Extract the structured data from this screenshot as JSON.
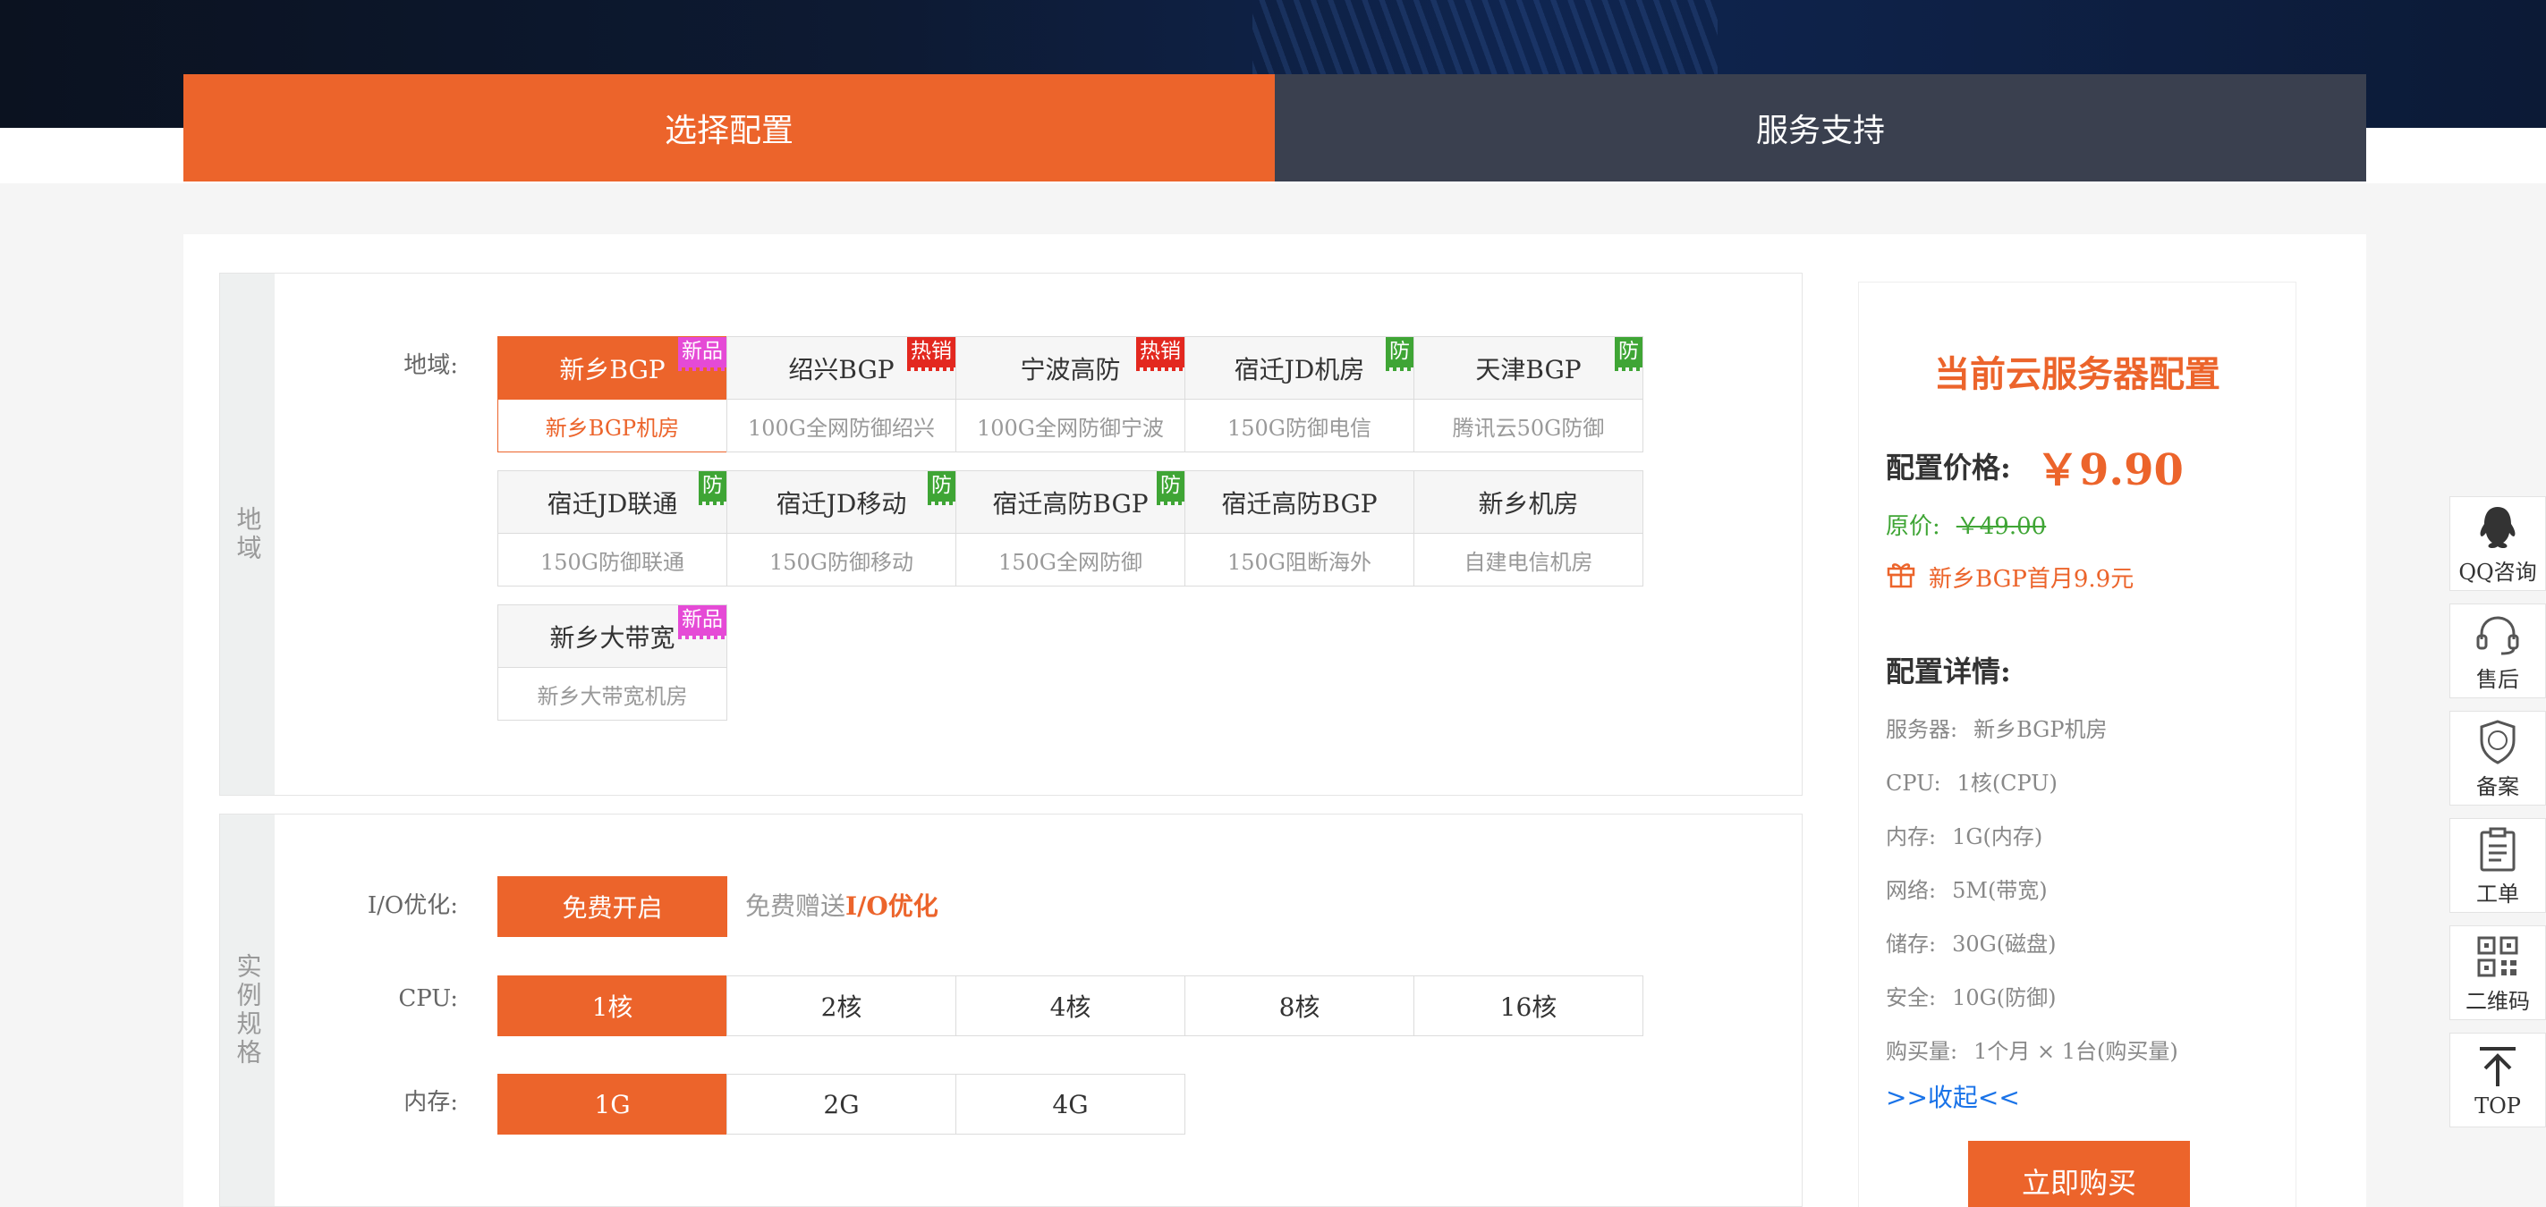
{
  "tabs": [
    {
      "label": "选择配置",
      "active": true
    },
    {
      "label": "服务支持",
      "active": false
    }
  ],
  "region_section": {
    "side_label": "地域",
    "row_label": "地域:",
    "regions": [
      {
        "name": "新乡BGP",
        "desc": "新乡BGP机房",
        "badge": "新品",
        "badge_type": "new",
        "active": true
      },
      {
        "name": "绍兴BGP",
        "desc": "100G全网防御绍兴",
        "badge": "热销",
        "badge_type": "hot",
        "active": false
      },
      {
        "name": "宁波高防",
        "desc": "100G全网防御宁波",
        "badge": "热销",
        "badge_type": "hot",
        "active": false
      },
      {
        "name": "宿迁JD机房",
        "desc": "150G防御电信",
        "badge": "防",
        "badge_type": "def",
        "active": false
      },
      {
        "name": "天津BGP",
        "desc": "腾讯云50G防御",
        "badge": "防",
        "badge_type": "def",
        "active": false
      },
      {
        "name": "宿迁JD联通",
        "desc": "150G防御联通",
        "badge": "防",
        "badge_type": "def",
        "active": false
      },
      {
        "name": "宿迁JD移动",
        "desc": "150G防御移动",
        "badge": "防",
        "badge_type": "def",
        "active": false
      },
      {
        "name": "宿迁高防BGP",
        "desc": "150G全网防御",
        "badge": "防",
        "badge_type": "def",
        "active": false
      },
      {
        "name": "宿迁高防BGP",
        "desc": "150G阻断海外",
        "badge": "",
        "badge_type": "",
        "active": false
      },
      {
        "name": "新乡机房",
        "desc": "自建电信机房",
        "badge": "",
        "badge_type": "",
        "active": false
      },
      {
        "name": "新乡大带宽",
        "desc": "新乡大带宽机房",
        "badge": "新品",
        "badge_type": "new",
        "active": false
      }
    ]
  },
  "spec_section": {
    "side_label": "实例规格",
    "io_label": "I/O优化:",
    "io_button": "免费开启",
    "io_note_prefix": "免费赠送",
    "io_note_highlight": "I/O优化",
    "cpu_label": "CPU:",
    "cpu_options": [
      "1核",
      "2核",
      "4核",
      "8核",
      "16核"
    ],
    "cpu_selected": 0,
    "mem_label": "内存:",
    "mem_options": [
      "1G",
      "2G",
      "4G"
    ],
    "mem_selected": 0
  },
  "summary": {
    "title": "当前云服务器配置",
    "price_label": "配置价格:",
    "price": "￥9.90",
    "original_label": "原价:",
    "original_price": "￥49.00",
    "promo": "新乡BGP首月9.9元",
    "detail_title": "配置详情:",
    "details": [
      {
        "k": "服务器:",
        "v": "新乡BGP机房"
      },
      {
        "k": "CPU:",
        "v": "1核(CPU)"
      },
      {
        "k": "内存:",
        "v": "1G(内存)"
      },
      {
        "k": "网络:",
        "v": "5M(带宽)"
      },
      {
        "k": "储存:",
        "v": "30G(磁盘)"
      },
      {
        "k": "安全:",
        "v": "10G(防御)"
      },
      {
        "k": "购买量:",
        "v": "1个月 × 1台(购买量)"
      }
    ],
    "collapse": ">>收起<<",
    "buy": "立即购买"
  },
  "float_bar": [
    {
      "label": "QQ咨询",
      "icon": "qq-icon"
    },
    {
      "label": "售后",
      "icon": "headset-icon"
    },
    {
      "label": "备案",
      "icon": "icp-shield-icon"
    },
    {
      "label": "工单",
      "icon": "clipboard-icon"
    },
    {
      "label": "二维码",
      "icon": "qrcode-icon"
    },
    {
      "label": "TOP",
      "icon": "arrow-top-icon"
    }
  ],
  "colors": {
    "accent": "#ec642b",
    "dark_tab": "#3a404f",
    "green": "#3fa535",
    "link": "#1a73e8"
  }
}
